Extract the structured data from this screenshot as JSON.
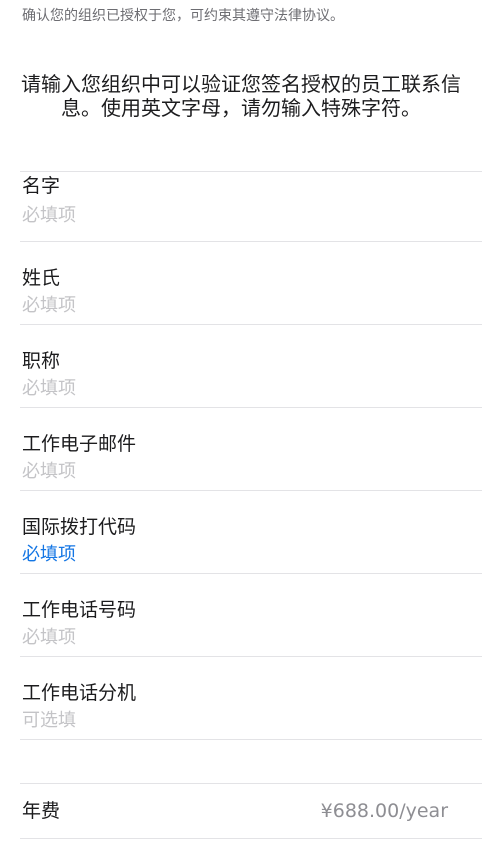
{
  "top_note": "确认您的组织已授权于您，可约束其遵守法律协议。",
  "instructions": "请输入您组织中可以验证您签名授权的员工联系信息。使用英文字母，请勿输入特殊字符。",
  "fields": [
    {
      "label": "名字",
      "placeholder": "必填项",
      "active": false
    },
    {
      "label": "姓氏",
      "placeholder": "必填项",
      "active": false
    },
    {
      "label": "职称",
      "placeholder": "必填项",
      "active": false
    },
    {
      "label": "工作电子邮件",
      "placeholder": "必填项",
      "active": false
    },
    {
      "label": "国际拨打代码",
      "placeholder": "必填项",
      "active": true
    },
    {
      "label": "工作电话号码",
      "placeholder": "必填项",
      "active": false
    },
    {
      "label": "工作电话分机",
      "placeholder": "可选填",
      "active": false
    }
  ],
  "fee": {
    "label": "年费",
    "value": "¥688.00/year"
  },
  "colors": {
    "placeholder": "#c4c4c7",
    "active_placeholder": "#1476e4",
    "separator": "#e3e3e6"
  }
}
